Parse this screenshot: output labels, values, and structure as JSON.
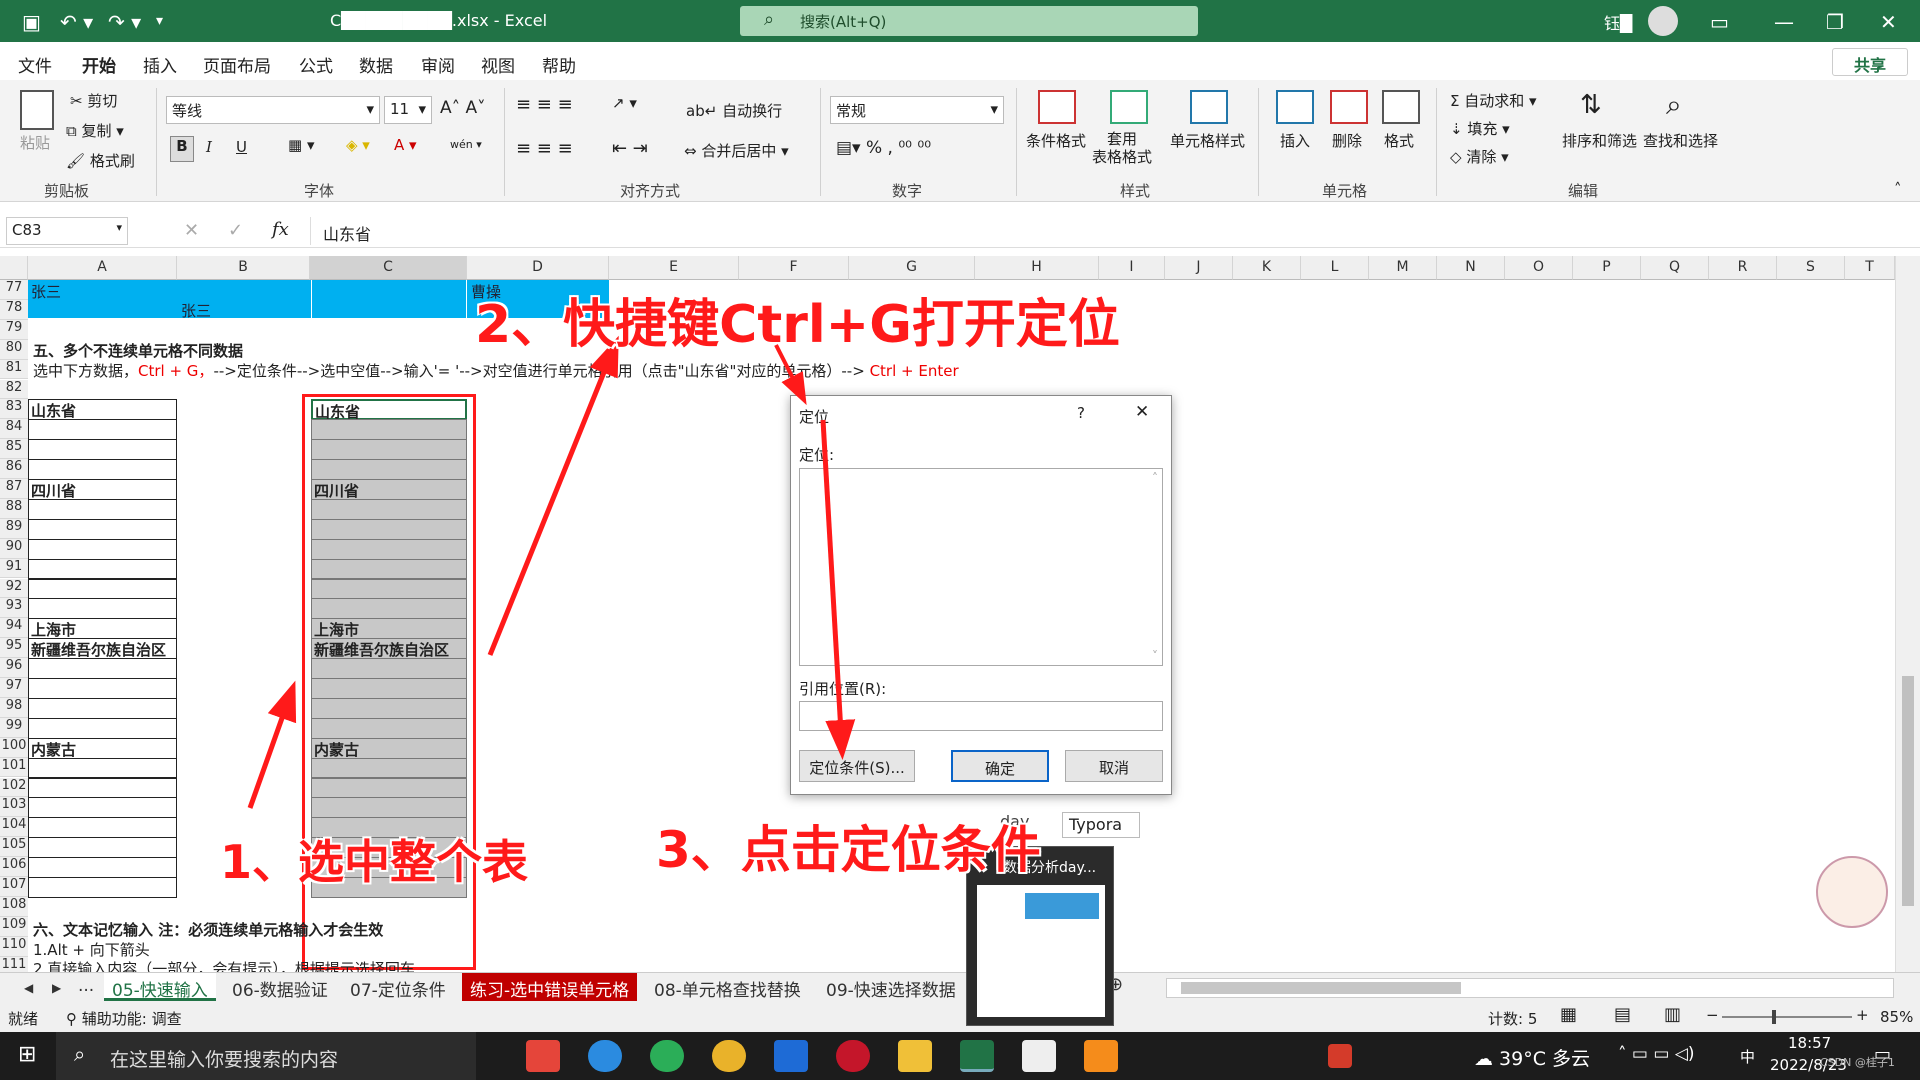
{
  "titlebar": {
    "filename": "C█████████.xlsx",
    "app": "Excel",
    "search": "搜索(Alt+Q)",
    "user": "钰█"
  },
  "menu": [
    "文件",
    "开始",
    "插入",
    "页面布局",
    "公式",
    "数据",
    "审阅",
    "视图",
    "帮助"
  ],
  "share": "共享",
  "ribbon": {
    "clipboard": {
      "paste": "粘贴",
      "cut": "剪切",
      "copy": "复制",
      "format_painter": "格式刷",
      "group": "剪贴板"
    },
    "font": {
      "name": "等线",
      "size": "11",
      "group": "字体",
      "bold": "B",
      "italic": "I",
      "underline": "U"
    },
    "align": {
      "wrap": "自动换行",
      "merge": "合并后居中",
      "group": "对齐方式"
    },
    "number": {
      "format": "常规",
      "group": "数字"
    },
    "styles": {
      "cond": "条件格式",
      "table": "套用\n表格格式",
      "cell": "单元格样式",
      "group": "样式"
    },
    "cells": {
      "insert": "插入",
      "delete": "删除",
      "format": "格式",
      "group": "单元格"
    },
    "edit": {
      "autosum": "自动求和",
      "fill": "填充",
      "clear": "清除",
      "sort": "排序和筛选",
      "find": "查找和选择",
      "group": "编辑"
    }
  },
  "formula": {
    "namebox": "C83",
    "fx": "fx",
    "value": "山东省"
  },
  "columns": [
    "A",
    "B",
    "C",
    "D",
    "E",
    "F",
    "G",
    "H",
    "I",
    "J",
    "K",
    "L",
    "M",
    "N",
    "O",
    "P",
    "Q",
    "R",
    "S",
    "T"
  ],
  "rows": [
    "77",
    "78",
    "79",
    "80",
    "81",
    "82",
    "83",
    "84",
    "85",
    "86",
    "87",
    "88",
    "89",
    "90",
    "91",
    "92",
    "93",
    "94",
    "95",
    "96",
    "97",
    "98",
    "99",
    "100",
    "101",
    "102",
    "103",
    "104",
    "105",
    "106",
    "107",
    "108",
    "109",
    "110",
    "111"
  ],
  "cells": {
    "a77": "张三",
    "b78": "张三",
    "d77": "曹操",
    "a80": "五、多个不连续单元格不同数据",
    "a81_black1": "选中下方数据，",
    "a81_red1": "Ctrl + G，",
    "a81_black2": "-->定位条件-->选中空值-->输入'= '-->对空值进行单元格引用（点击\"山东省\"对应的单元格）-->",
    "a81_red2": " Ctrl + Enter",
    "a109": "六、文本记忆输入    注：必须连续单元格输入才会生效",
    "a110": "1.Alt + 向下箭头",
    "a111": "2.直接输入内容（一部分，会有提示），根据提示选择回车"
  },
  "colA": {
    "83": "山东省",
    "87": "四川省",
    "94": "上海市",
    "95": "新疆维吾尔族自治区",
    "100": "内蒙古"
  },
  "colC": {
    "83": "山东省",
    "87": "四川省",
    "94": "上海市",
    "95": "新疆维吾尔族自治区",
    "100": "内蒙古"
  },
  "dialog": {
    "title": "定位",
    "help": "?",
    "close": "✕",
    "list_label": "定位:",
    "ref_label": "引用位置(R):",
    "special": "定位条件(S)...",
    "ok": "确定",
    "cancel": "取消"
  },
  "tabs": [
    "...",
    "05-快速输入",
    "06-数据验证",
    "07-定位条件",
    "练习-选中错误单元格",
    "08-单元格查找替换",
    "09-快速选择数据"
  ],
  "status": {
    "ready": "就绪",
    "access": "辅助功能: 调查",
    "count": "计数: 5",
    "zoom": "85%"
  },
  "popup": {
    "title": "数据分析day...",
    "typora": "Typora",
    "day": "day"
  },
  "taskbar": {
    "search": "在这里输入你要搜索的内容",
    "weather": "39°C 多云",
    "time": "18:57",
    "date": "2022/8/23",
    "watermark": "CSDN @桂子1"
  },
  "annotations": {
    "step1": "1、选中整个表",
    "step2": "2、快捷键Ctrl+G打开定位",
    "step3": "3、点击定位条件"
  },
  "colors": {
    "excel_green": "#217346",
    "highlight_blue": "#00b0f0",
    "red": "#ff1a1a",
    "tab_red": "#c00000"
  }
}
